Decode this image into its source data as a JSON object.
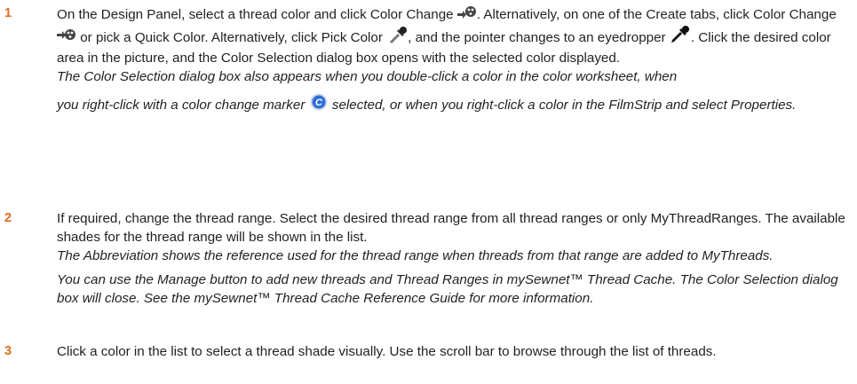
{
  "steps": [
    {
      "number": "1",
      "instruction": {
        "t1": "On the Design Panel, select a thread color and click Color Change",
        "t2": ". Alternatively, on one of the Create tabs, click Color Change",
        "t3": " or pick a Quick Color. Alternatively, click Pick Color",
        "t4": ", and the pointer changes to an eyedropper",
        "t5": ". Click the desired color area in the picture, and the Color Selection dialog box opens with the selected color displayed."
      },
      "note": {
        "t1": "The Color Selection dialog box also appears when you double-click a color in the color worksheet, when",
        "t2": "you right-click with a color change marker",
        "t3": " selected, or when you right-click a color in the FilmStrip and select Properties."
      }
    },
    {
      "number": "2",
      "instruction": "If required, change the thread range. Select the desired thread range from all thread ranges or only MyThreadRanges. The available shades for the thread range will be shown in the list.",
      "note1": "The Abbreviation shows the reference used for the thread range when threads from that range are added to MyThreads.",
      "note2": "You can use the Manage button to add new threads and Thread Ranges in mySewnet™ Thread Cache. The Color Selection dialog box will close. See the mySewnet™ Thread Cache Reference Guide for more information."
    },
    {
      "number": "3",
      "instruction": "Click a color in the list to select a thread shade visually. Use the scroll bar to browse through the list of threads."
    }
  ],
  "icons": {
    "color_change": "color-change-icon",
    "pick_color": "pick-color-eyedropper-icon",
    "eyedropper_pointer": "eyedropper-pointer-icon",
    "color_change_marker": "color-change-marker-icon",
    "marker_letter": "C"
  },
  "colors": {
    "step_number": "#e46c1b",
    "text": "#231f20",
    "marker_blue": "#2e6fd8"
  }
}
